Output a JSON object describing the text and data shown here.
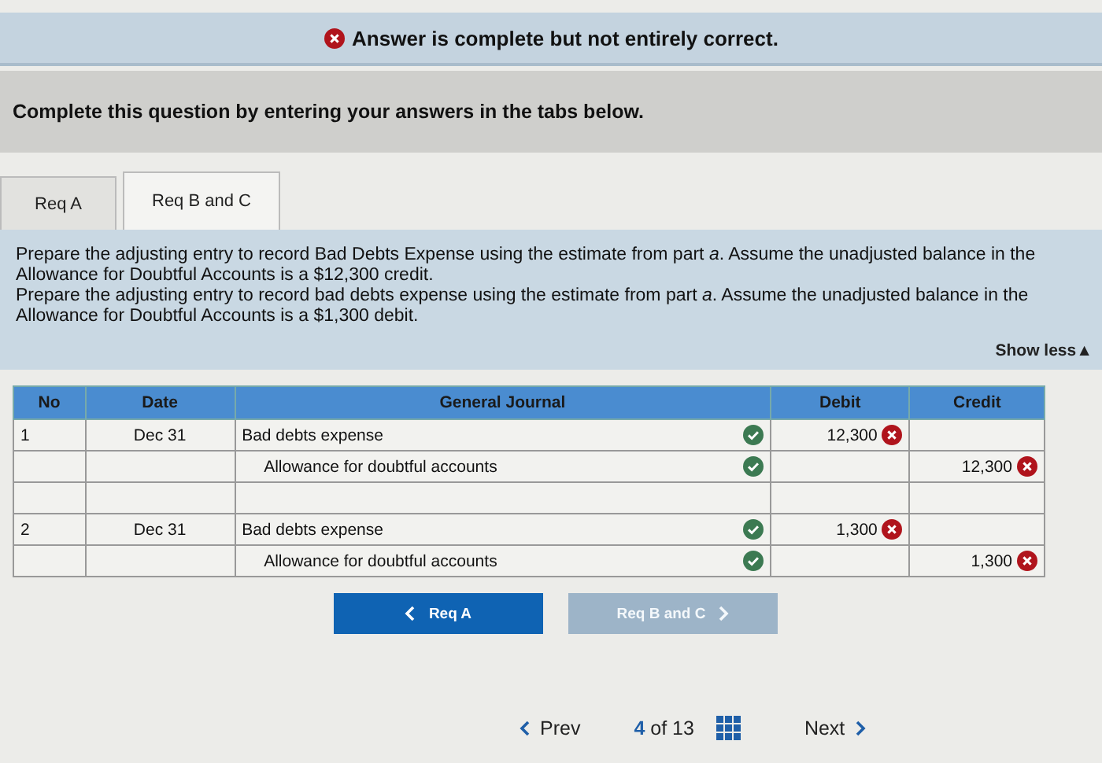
{
  "banner": {
    "correct": false,
    "message": "Answer is complete but not entirely correct."
  },
  "instruction": "Complete this question by entering your answers in the tabs below.",
  "tabs": [
    {
      "label": "Req A",
      "selected": false
    },
    {
      "label": "Req B and C",
      "selected": true
    }
  ],
  "prompt": {
    "paragraphs": [
      "Prepare the adjusting entry to record Bad Debts Expense using the estimate from part *a*. Assume the unadjusted balance in the Allowance for Doubtful Accounts is a $12,300 credit.",
      "Prepare the adjusting entry to record bad debts expense using the estimate from part *a*. Assume the unadjusted balance in the Allowance for Doubtful Accounts is a $1,300 debit."
    ],
    "toggle": "Show less▲"
  },
  "table": {
    "columns": [
      "No",
      "Date",
      "General Journal",
      "Debit",
      "Credit"
    ],
    "rows": [
      {
        "no": "1",
        "date": "Dec 31",
        "account": "Bad debts expense",
        "indented": false,
        "account_correct": true,
        "debit": "12,300",
        "debit_correct": false
      },
      {
        "account": "Allowance for doubtful accounts",
        "indented": true,
        "account_correct": true,
        "credit": "12,300",
        "credit_correct": false
      },
      {},
      {
        "no": "2",
        "date": "Dec 31",
        "account": "Bad debts expense",
        "indented": false,
        "account_correct": true,
        "debit": "1,300",
        "debit_correct": false
      },
      {
        "account": "Allowance for doubtful accounts",
        "indented": true,
        "account_correct": true,
        "credit": "1,300",
        "credit_correct": false
      }
    ]
  },
  "tab_nav": [
    {
      "label": "Req A",
      "kind": "prev",
      "disabled": false
    },
    {
      "label": "Req B and C",
      "kind": "next",
      "disabled": true
    }
  ],
  "pager": {
    "prev": "Prev",
    "position": "**4** of 13",
    "next": "Next"
  }
}
